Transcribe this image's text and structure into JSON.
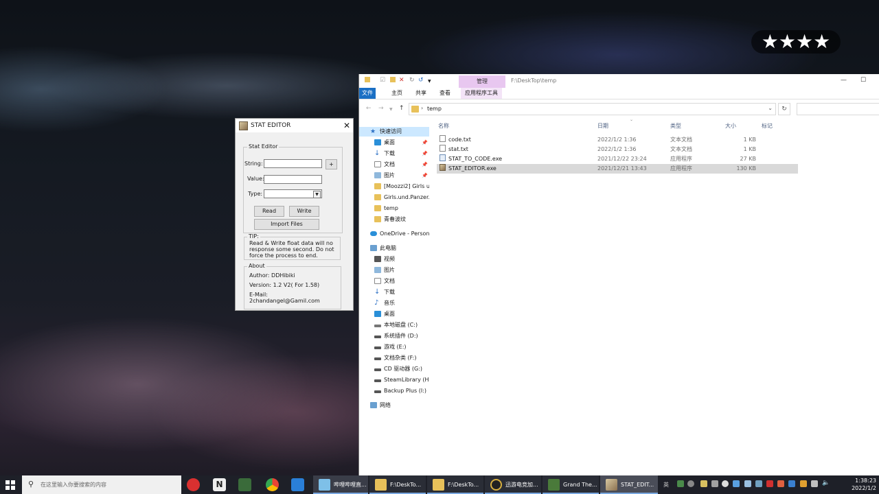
{
  "overlay": {
    "stars": "★★★★"
  },
  "stat_editor": {
    "title": "STAT EDITOR",
    "group_label": "Stat Editor",
    "string_label": "String:",
    "value_label": "Value:",
    "type_label": "Type:",
    "plus_label": "+",
    "read_label": "Read",
    "write_label": "Write",
    "import_label": "Import Files",
    "tip_label": "TIP:",
    "tip_line1": "Read & Write float data will no",
    "tip_line2": "response some second. Do not",
    "tip_line3": "force the process to end.",
    "about_label": "About",
    "author": "Author:  DDHibiki",
    "version": "Version:  1.2 V2( For 1.58)",
    "email_label": "E-Mail:",
    "email": "2chandangel@Gamil.com"
  },
  "explorer": {
    "manage_tab": "管理",
    "title_path": "F:\\DeskTop\\temp",
    "tabs": [
      "文件",
      "主页",
      "共享",
      "查看",
      "应用程序工具"
    ],
    "breadcrumb_sep": "›",
    "breadcrumb": "temp",
    "columns": {
      "name": "名称",
      "date": "日期",
      "type": "类型",
      "size": "大小",
      "tags": "标记"
    },
    "nav": [
      {
        "label": "快速访问"
      },
      {
        "label": "桌面"
      },
      {
        "label": "下载"
      },
      {
        "label": "文档"
      },
      {
        "label": "图片"
      },
      {
        "label": "[Moozzi2] Girls u"
      },
      {
        "label": "Girls.und.Panzer.t"
      },
      {
        "label": "temp"
      },
      {
        "label": "青春波纹"
      },
      {
        "label": "OneDrive - Person"
      },
      {
        "label": "此电脑"
      },
      {
        "label": "视频"
      },
      {
        "label": "图片"
      },
      {
        "label": "文档"
      },
      {
        "label": "下载"
      },
      {
        "label": "音乐"
      },
      {
        "label": "桌面"
      },
      {
        "label": "本地磁盘 (C:)"
      },
      {
        "label": "系统插件 (D:)"
      },
      {
        "label": "游戏 (E:)"
      },
      {
        "label": "文档杂类 (F:)"
      },
      {
        "label": "CD 驱动器 (G:)"
      },
      {
        "label": "SteamLibrary (H:)"
      },
      {
        "label": "Backup Plus (I:)"
      },
      {
        "label": "网络"
      }
    ],
    "files": [
      {
        "name": "code.txt",
        "date": "2022/1/2 1:36",
        "type": "文本文档",
        "size": "1 KB"
      },
      {
        "name": "stat.txt",
        "date": "2022/1/2 1:36",
        "type": "文本文档",
        "size": "1 KB"
      },
      {
        "name": "STAT_TO_CODE.exe",
        "date": "2021/12/22 23:24",
        "type": "应用程序",
        "size": "27 KB"
      },
      {
        "name": "STAT_EDITOR.exe",
        "date": "2021/12/21 13:43",
        "type": "应用程序",
        "size": "130 KB"
      }
    ]
  },
  "taskbar": {
    "search_placeholder": "在这里输入你要搜索的内容",
    "tasks": [
      {
        "label": "哔哩哔哩直..."
      },
      {
        "label": "F:\\DeskTo..."
      },
      {
        "label": "F:\\DeskTo..."
      },
      {
        "label": "迅游电竞加..."
      },
      {
        "label": "Grand The..."
      },
      {
        "label": "STAT_EDIT..."
      }
    ],
    "ime": "英",
    "time": "1:38:23",
    "date": "2022/1/2"
  }
}
